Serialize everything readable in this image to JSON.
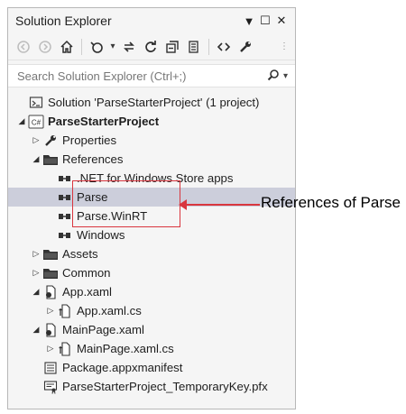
{
  "window": {
    "title": "Solution Explorer",
    "dropdown_glyph": "▼",
    "pin_glyph": "☐",
    "close_glyph": "✕"
  },
  "toolbar": {
    "back": "◀",
    "forward": "▶",
    "home": "⌂",
    "history": "⟲",
    "history_dropdown": "▾",
    "sync": "⇄",
    "refresh": "↻",
    "collapse": "⧉",
    "show_all": "▤",
    "code": "‹›",
    "properties": "🔧",
    "overflow": "⋮"
  },
  "search": {
    "placeholder": "Search Solution Explorer (Ctrl+;)",
    "icon": "⚲",
    "dropdown": "▾"
  },
  "tree": [
    {
      "label": "Solution 'ParseStarterProject' (1 project)",
      "icon": "solution-icon",
      "level": 0,
      "arrow": "",
      "bold": false
    },
    {
      "label": "ParseStarterProject",
      "icon": "csharp-project-icon",
      "level": 0,
      "arrow": "◢",
      "bold": true
    },
    {
      "label": "Properties",
      "icon": "wrench-icon",
      "level": 1,
      "arrow": "▷",
      "bold": false
    },
    {
      "label": "References",
      "icon": "folder-icon",
      "level": 1,
      "arrow": "◢",
      "bold": false
    },
    {
      "label": ".NET for Windows Store apps",
      "icon": "reference-icon",
      "level": 2,
      "arrow": "",
      "bold": false
    },
    {
      "label": "Parse",
      "icon": "reference-icon",
      "level": 2,
      "arrow": "",
      "bold": false,
      "selected": true
    },
    {
      "label": "Parse.WinRT",
      "icon": "reference-icon",
      "level": 2,
      "arrow": "",
      "bold": false
    },
    {
      "label": "Windows",
      "icon": "reference-icon",
      "level": 2,
      "arrow": "",
      "bold": false
    },
    {
      "label": "Assets",
      "icon": "folder-icon",
      "level": 1,
      "arrow": "▷",
      "bold": false
    },
    {
      "label": "Common",
      "icon": "folder-icon",
      "level": 1,
      "arrow": "▷",
      "bold": false
    },
    {
      "label": "App.xaml",
      "icon": "xaml-file-icon",
      "level": 1,
      "arrow": "◢",
      "bold": false
    },
    {
      "label": "App.xaml.cs",
      "icon": "cs-file-icon",
      "level": 2,
      "arrow": "▷",
      "bold": false
    },
    {
      "label": "MainPage.xaml",
      "icon": "xaml-file-icon",
      "level": 1,
      "arrow": "◢",
      "bold": false
    },
    {
      "label": "MainPage.xaml.cs",
      "icon": "cs-file-icon",
      "level": 2,
      "arrow": "▷",
      "bold": false
    },
    {
      "label": "Package.appxmanifest",
      "icon": "manifest-icon",
      "level": 1,
      "arrow": "",
      "bold": false
    },
    {
      "label": "ParseStarterProject_TemporaryKey.pfx",
      "icon": "certificate-icon",
      "level": 1,
      "arrow": "",
      "bold": false
    }
  ],
  "annotation": {
    "text": "References of Parse",
    "color": "#d9363e"
  },
  "colors": {
    "selection": "#cccedb",
    "panel_bg": "#f5f5f5"
  }
}
